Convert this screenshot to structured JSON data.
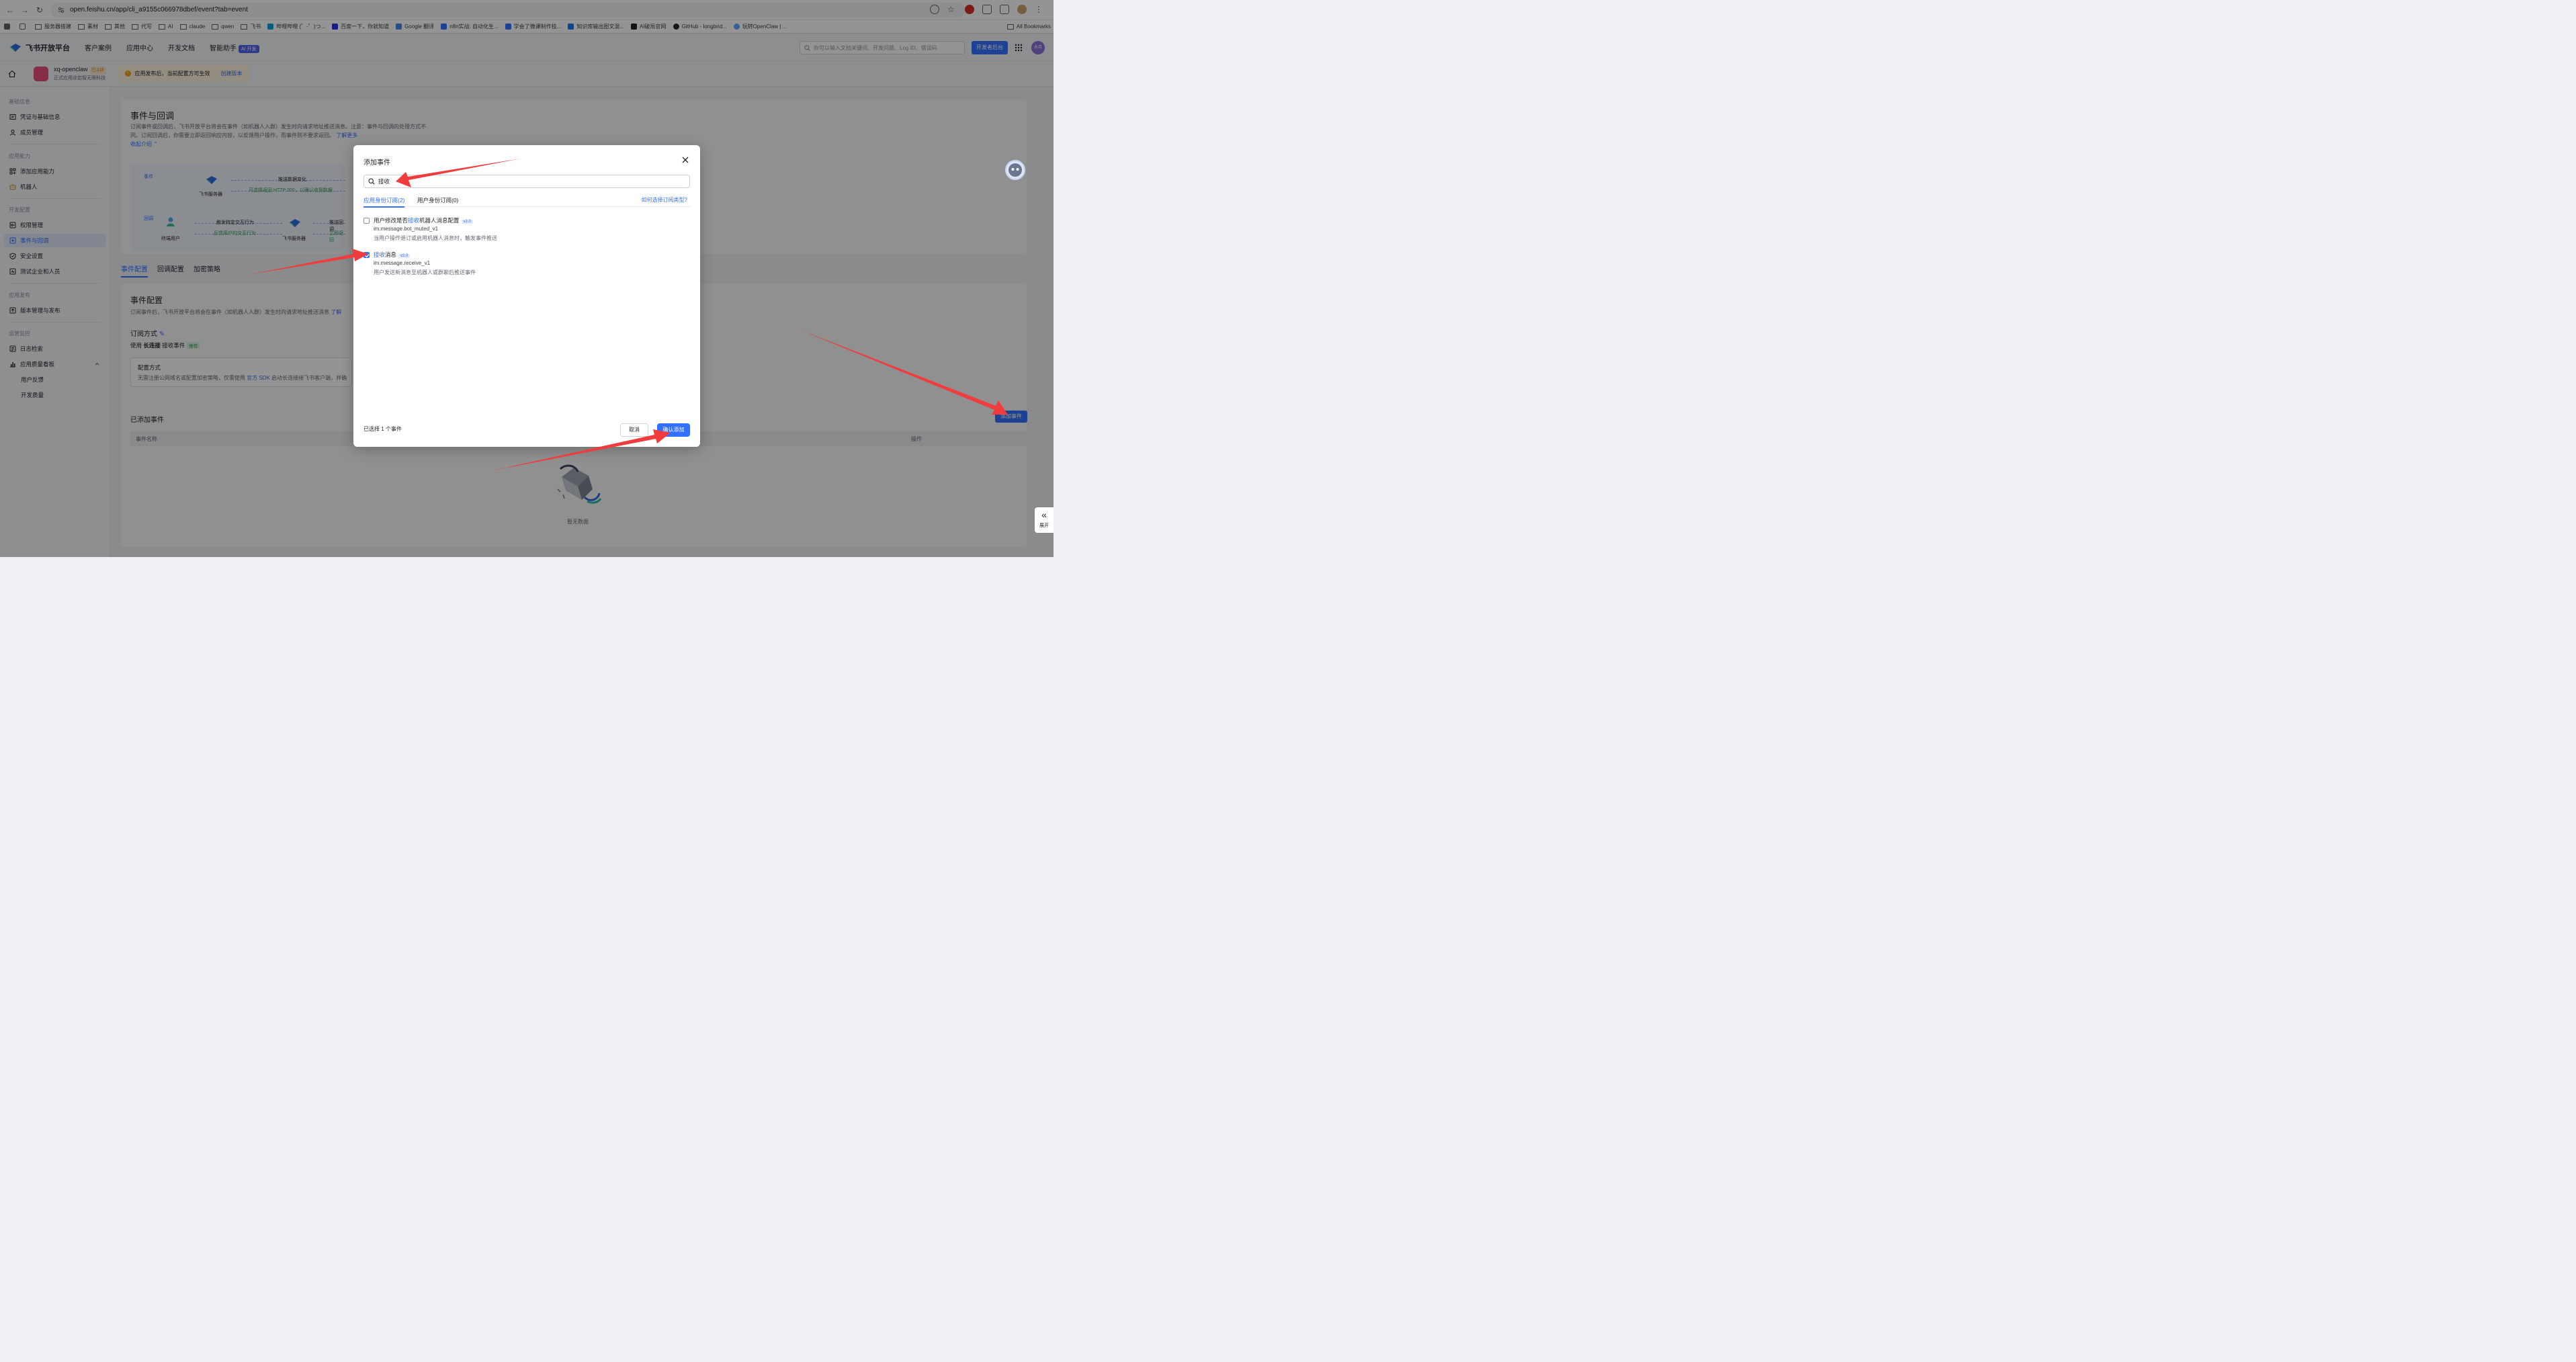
{
  "browser": {
    "url": "open.feishu.cn/app/cli_a9155c066978dbef/event?tab=event",
    "bookmarks": [
      "服务器搭建",
      "素材",
      "其他",
      "代写",
      "AI",
      "claude",
      "qwen",
      "飞书",
      "哔哩哔哩 (゜-゜)つ...",
      "百度一下，你就知道",
      "Google 翻译",
      "n8n实战: 自动化生...",
      "学会了微课制作技...",
      "知识库输出图文混...",
      "AI破局官网",
      "GitHub - longbrid...",
      "玩转OpenClaw | ..."
    ],
    "all_bookmarks": "All Bookmarks"
  },
  "topnav": {
    "logo": "飞书开放平台",
    "items": [
      "客户案例",
      "应用中心",
      "开发文档",
      "智能助手"
    ],
    "ai_badge": "AI 开发",
    "search_placeholder": "你可以输入文档关键词、开发问题、Log ID、错误码",
    "dev_button": "开发者后台",
    "avatar": "永月"
  },
  "app": {
    "name": "xq-openclaw",
    "status": "已上线",
    "subtitle": "正式应用@启智无限科技",
    "notice": "应用发布后，当前配置方可生效",
    "notice_link": "创建版本"
  },
  "sidebar": {
    "groups": [
      "基础信息",
      "应用能力",
      "开发配置",
      "应用发布",
      "运营监控"
    ],
    "items": [
      "凭证与基础信息",
      "成员管理",
      "添加应用能力",
      "机器人",
      "权限管理",
      "事件与回调",
      "安全设置",
      "测试企业和人员",
      "版本管理与发布",
      "日志检索",
      "应用质量看板",
      "用户反馈",
      "开发质量"
    ]
  },
  "main": {
    "title": "事件与回调",
    "desc1": "订阅事件或回调后，飞书开放平台将会在事件（如机器人入群）发生时向请求地址推送消息。注意：事件与回调的处理方式不",
    "desc2": "同。订阅回调后，你需要立即返回响应内容，以反馈用户操作，而事件则不要求返回。",
    "learn_more": "了解更多",
    "collapse": "收起介绍",
    "flow": {
      "tag_event": "事件",
      "tag_callback": "回调",
      "server": "飞书服务器",
      "user": "终端用户",
      "push_change": "推送数据变化",
      "http200": "可选择返回 HTTP 200，以确认收到数据",
      "trigger": "触发特定交互行为",
      "feedback": "反馈用户的交互行为",
      "push_cb": "推送回调",
      "immediate": "立即返回"
    },
    "tabs": [
      "事件配置",
      "回调配置",
      "加密策略"
    ],
    "event_config_title": "事件配置",
    "event_config_desc": "订阅事件后，飞书开放平台将会在事件（如机器人入群）发生时向请求地址推送消息",
    "event_config_desc_link": "了解",
    "sub_mode_label": "订阅方式",
    "sub_mode_prefix": "使用",
    "sub_mode_bold": "长连接",
    "sub_mode_suffix": "接收事件",
    "recommend": "推荐",
    "conf_title": "配置方式",
    "conf_desc_a": "无需注册公网域名或配置加密策略，仅需使用",
    "conf_desc_link": "官方 SDK",
    "conf_desc_b": "启动长连接接飞书客户端，并确",
    "added_title": "已添加事件",
    "add_button": "添加事件",
    "col_name": "事件名称",
    "col_action": "操作",
    "empty": "暂无数据"
  },
  "modal": {
    "title": "添加事件",
    "search_value": "接收",
    "tabs": [
      "应用身份订阅(2)",
      "用户身份订阅(0)"
    ],
    "help": "如何选择订阅类型?",
    "events": [
      {
        "name_a": "用户修改是否",
        "name_hl": "接收",
        "name_b": "机器人消息配置",
        "version": "v2.0",
        "code": "im.message.bot_muted_v1",
        "desc": "当用户操作退订或启用机器人消息时，触发事件推送",
        "checked": false
      },
      {
        "name_a": "",
        "name_hl": "接收",
        "name_b": "消息",
        "version": "v2.0",
        "code": "im.message.receive_v1",
        "desc": "用户发送新消息至机器人或群聊后推送事件",
        "checked": true
      }
    ],
    "selected_count": "已选择 1 个事件",
    "cancel": "取消",
    "confirm": "确认添加"
  },
  "expand_label": "展开",
  "colors": {
    "primary": "#3370ff",
    "arrow": "#f03c3c"
  }
}
